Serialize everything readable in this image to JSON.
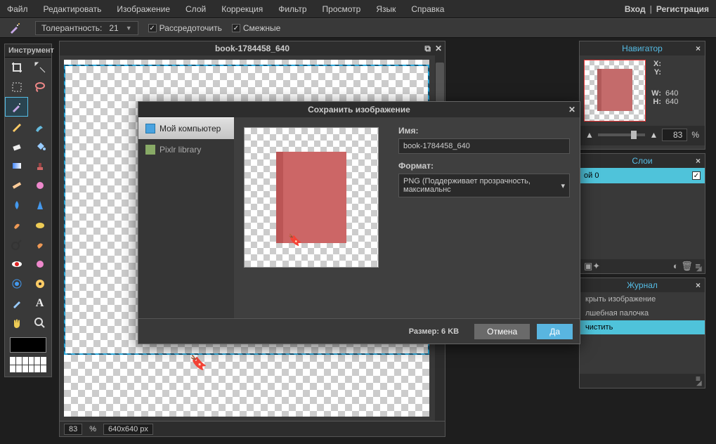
{
  "menu": {
    "items": [
      "Файл",
      "Редактировать",
      "Изображение",
      "Слой",
      "Коррекция",
      "Фильтр",
      "Просмотр",
      "Язык",
      "Справка"
    ],
    "login": "Вход",
    "signup": "Регистрация"
  },
  "toolbar": {
    "tolerance_label": "Толерантность:",
    "tolerance_value": "21",
    "scatter": "Рассредоточить",
    "contiguous": "Смежные"
  },
  "tools": {
    "title": "Инструмент"
  },
  "canvas": {
    "title": "book-1784458_640",
    "zoom": "83",
    "zoom_unit": "%",
    "dims": "640x640 px"
  },
  "navigator": {
    "title": "Навигатор",
    "x_label": "X:",
    "y_label": "Y:",
    "w_label": "W:",
    "h_label": "H:",
    "w": "640",
    "h": "640",
    "zoom": "83",
    "zoom_unit": "%"
  },
  "layers": {
    "title": "Слои",
    "layer0": "ой 0"
  },
  "history": {
    "title": "Журнал",
    "items": [
      "крыть изображение",
      "лшебная палочка",
      "чистить"
    ]
  },
  "dialog": {
    "title": "Сохранить изображение",
    "left_computer": "Мой компьютер",
    "left_pixlr": "Pixlr library",
    "name_label": "Имя:",
    "name_value": "book-1784458_640",
    "format_label": "Формат:",
    "format_value": "PNG (Поддерживает прозрачность, максимальнс",
    "size_label": "Размер: 6 KB",
    "cancel": "Отмена",
    "ok": "Да"
  }
}
